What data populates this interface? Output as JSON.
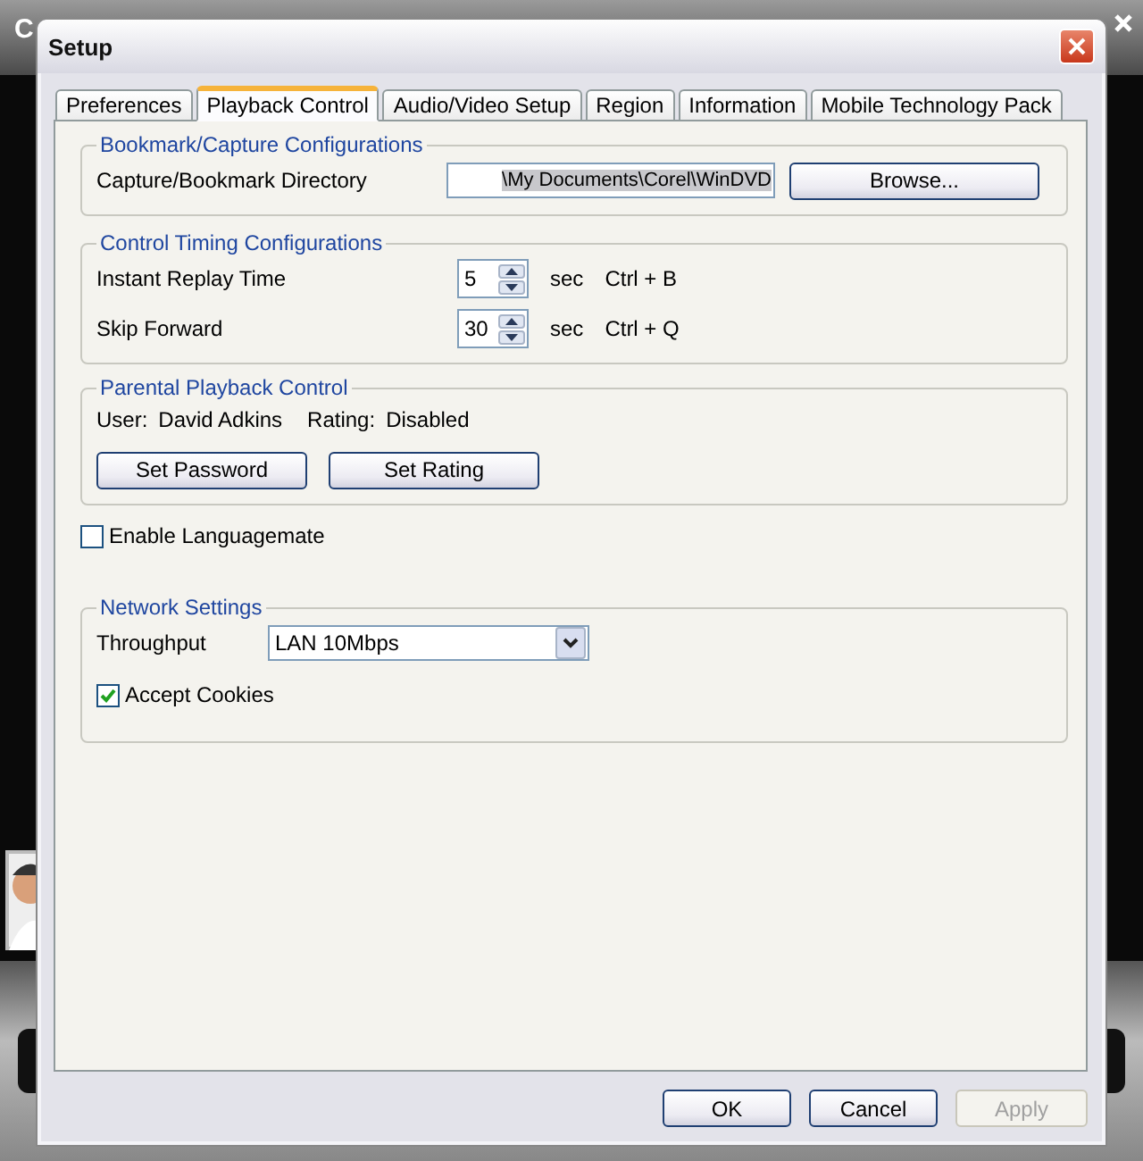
{
  "background_window": {
    "title": "C"
  },
  "dialog": {
    "title": "Setup"
  },
  "tabs": [
    {
      "label": "Preferences",
      "selected": false
    },
    {
      "label": "Playback Control",
      "selected": true
    },
    {
      "label": "Audio/Video Setup",
      "selected": false
    },
    {
      "label": "Region",
      "selected": false
    },
    {
      "label": "Information",
      "selected": false
    },
    {
      "label": "Mobile Technology Pack",
      "selected": false
    }
  ],
  "bookmark_group": {
    "title": "Bookmark/Capture Configurations",
    "label": "Capture/Bookmark Directory",
    "value": "\\My Documents\\Corel\\WinDVD",
    "button": "Browse..."
  },
  "timing_group": {
    "title": "Control Timing Configurations",
    "rows": [
      {
        "label": "Instant Replay Time",
        "value": "5",
        "unit": "sec",
        "shortcut": "Ctrl + B"
      },
      {
        "label": "Skip Forward",
        "value": "30",
        "unit": "sec",
        "shortcut": "Ctrl + Q"
      }
    ]
  },
  "parental_group": {
    "title": "Parental Playback Control",
    "user_label": "User:",
    "user": "David Adkins",
    "rating_label": "Rating:",
    "rating": "Disabled",
    "buttons": [
      "Set Password",
      "Set Rating"
    ]
  },
  "languagemate": {
    "label": "Enable Languagemate",
    "checked": false
  },
  "network_group": {
    "title": "Network Settings",
    "throughput_label": "Throughput",
    "throughput": "LAN 10Mbps",
    "cookies": {
      "label": "Accept Cookies",
      "checked": true
    }
  },
  "buttons": [
    {
      "label": "OK",
      "disabled": false
    },
    {
      "label": "Cancel",
      "disabled": false
    },
    {
      "label": "Apply",
      "disabled": true
    }
  ]
}
